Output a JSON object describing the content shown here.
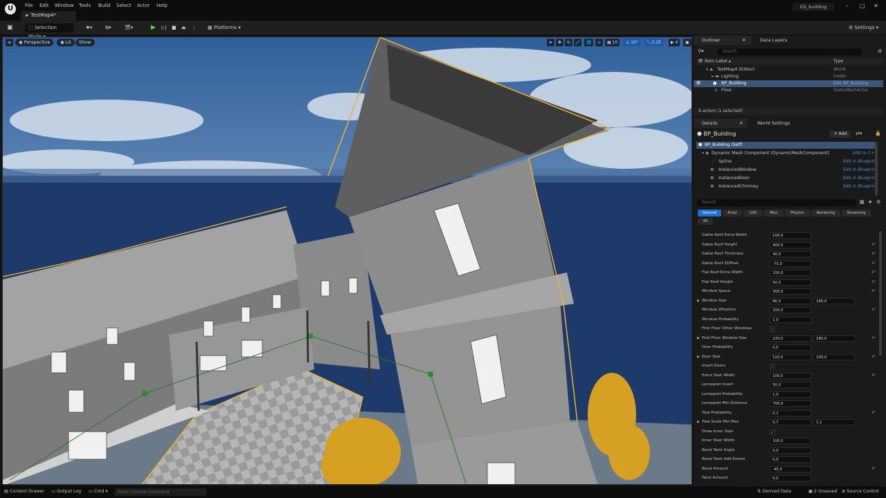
{
  "menu": [
    "File",
    "Edit",
    "Window",
    "Tools",
    "Build",
    "Select",
    "Actor",
    "Help"
  ],
  "tab": {
    "title": "TestMap4*"
  },
  "project": "GS_building",
  "window_buttons": [
    "–",
    "□",
    "✕"
  ],
  "toolbar": {
    "selection_mode": "Selection Mode",
    "platforms": "Platforms",
    "settings": "Settings"
  },
  "viewport": {
    "perspective": "Perspective",
    "lit": "Lit",
    "show": "Show",
    "grid_snap": "10",
    "rot_snap": "10°",
    "scale_snap": "0.25",
    "cam_speed": "4"
  },
  "outliner": {
    "tab": "Outliner",
    "tab2": "Data Layers",
    "search_placeholder": "Search",
    "col_label": "Item Label ▴",
    "col_type": "Type",
    "items": [
      {
        "label": "TestMap4 (Editor)",
        "type": "World"
      },
      {
        "label": "Lighting",
        "type": "Folder"
      },
      {
        "label": "BP_Building",
        "type": "Edit BP_Building"
      },
      {
        "label": "Floor",
        "type": "StaticMeshActor"
      }
    ],
    "count": "9 actors (1 selected)"
  },
  "details": {
    "tab": "Details",
    "tab2": "World Settings",
    "actor": "BP_Building",
    "add": "+ Add",
    "self": "BP_Building (Self)",
    "components": [
      {
        "label": "Dynamic Mesh Component (DynamicMeshComponent)",
        "action": "Edit in C++"
      },
      {
        "label": "Spline",
        "action": "Edit in Blueprint"
      },
      {
        "label": "InstancedWindow",
        "action": "Edit in Blueprint"
      },
      {
        "label": "InstancedDoor",
        "action": "Edit in Blueprint"
      },
      {
        "label": "InstancedChimney",
        "action": "Edit in Blueprint"
      }
    ],
    "search_placeholder": "Search",
    "categories": [
      "General",
      "Actor",
      "LOD",
      "Misc",
      "Physics",
      "Rendering",
      "Streaming",
      "All"
    ],
    "properties": [
      {
        "label": "Gable Roof Extra Width",
        "v1": "100,0",
        "reset": false
      },
      {
        "label": "Gable Roof Height",
        "v1": "400,0",
        "reset": true
      },
      {
        "label": "Gable Roof Thickness",
        "v1": "40,0",
        "reset": true
      },
      {
        "label": "Gable Roof ZOffset",
        "v1": "-75,0",
        "reset": true
      },
      {
        "label": "Flat Roof Extra Width",
        "v1": "100,0",
        "reset": true
      },
      {
        "label": "Flat Roof Height",
        "v1": "50,0",
        "reset": true
      },
      {
        "label": "Window Space",
        "v1": "300,0",
        "reset": true
      },
      {
        "label": "Window Size",
        "v1": "86,0",
        "v2": "166,0",
        "expand": true,
        "reset": false
      },
      {
        "label": "Window ZPosition",
        "v1": "200,0",
        "reset": true
      },
      {
        "label": "Window Probability",
        "v1": "1,0",
        "reset": false
      },
      {
        "label": "First Floor Other Windows",
        "check": true,
        "reset": false
      },
      {
        "label": "First Floor Window Size",
        "v1": "230,0",
        "v2": "180,0",
        "expand": true,
        "reset": true
      },
      {
        "label": "Door Probability",
        "v1": "0,5",
        "reset": false
      },
      {
        "label": "Door Size",
        "v1": "120,0",
        "v2": "230,0",
        "expand": true,
        "reset": true
      },
      {
        "label": "Insert Doors",
        "check": true,
        "reset": false
      },
      {
        "label": "Extra Stair Width",
        "v1": "100,0",
        "reset": true
      },
      {
        "label": "Lamppost Insert",
        "v1": "50,0",
        "reset": false
      },
      {
        "label": "Lamppost Probability",
        "v1": "1,0",
        "reset": false
      },
      {
        "label": "Lamppost Min Distance",
        "v1": "700,0",
        "reset": false
      },
      {
        "label": "Tree Probability",
        "v1": "0,2",
        "reset": true
      },
      {
        "label": "Tree Scale Min Max",
        "v1": "0,7",
        "v2": "1,1",
        "expand": true,
        "reset": false
      },
      {
        "label": "Draw Inner Stair",
        "check": true,
        "reset": false
      },
      {
        "label": "Inner Stair Width",
        "v1": "100,0",
        "reset": false
      },
      {
        "label": "Bend Twist Angle",
        "v1": "0,0",
        "reset": false
      },
      {
        "label": "Bend Twist Add Extent",
        "v1": "0,0",
        "reset": false
      },
      {
        "label": "Bend Amount",
        "v1": "-45,0",
        "reset": true
      },
      {
        "label": "Twist Amount",
        "v1": "0,0",
        "reset": false
      }
    ]
  },
  "statusbar": {
    "content_drawer": "Content Drawer",
    "output_log": "Output Log",
    "cmd": "Cmd",
    "console_placeholder": "Enter Console Command",
    "derived_data": "Derived Data",
    "unsaved": "2 Unsaved",
    "source_control": "Source Control"
  }
}
